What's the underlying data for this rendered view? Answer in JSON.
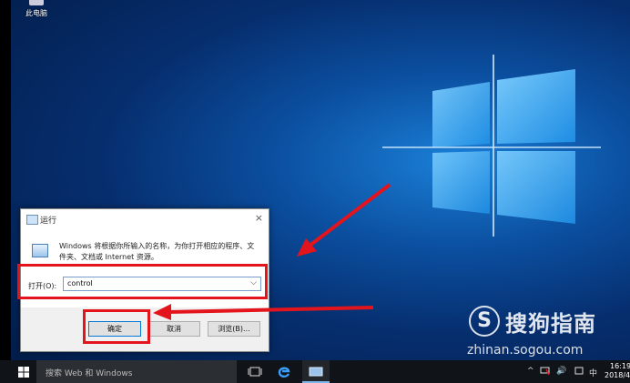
{
  "desktop": {
    "this_pc_label": "此电脑"
  },
  "run_dialog": {
    "title": "运行",
    "close_glyph": "×",
    "description": "Windows 将根据你所输入的名称，为你打开相应的程序、文件夹、文档或 Internet 资源。",
    "open_label": "打开(O):",
    "open_value": "control",
    "dropdown_glyph": "⌵",
    "ok_label": "确定",
    "cancel_label": "取消",
    "browse_label": "浏览(B)..."
  },
  "watermark": {
    "logo_letter": "S",
    "brand": "搜狗指南",
    "url": "zhinan.sogou.com"
  },
  "taskbar": {
    "search_placeholder": "搜索 Web 和 Windows",
    "tray": {
      "chevron": "^",
      "volume": "🔊",
      "ime": "中"
    },
    "clock_time": "16:19",
    "clock_date": "2018/4/"
  },
  "colors": {
    "highlight": "#e4141c",
    "taskbar": "#101418",
    "accent": "#0078d7"
  }
}
